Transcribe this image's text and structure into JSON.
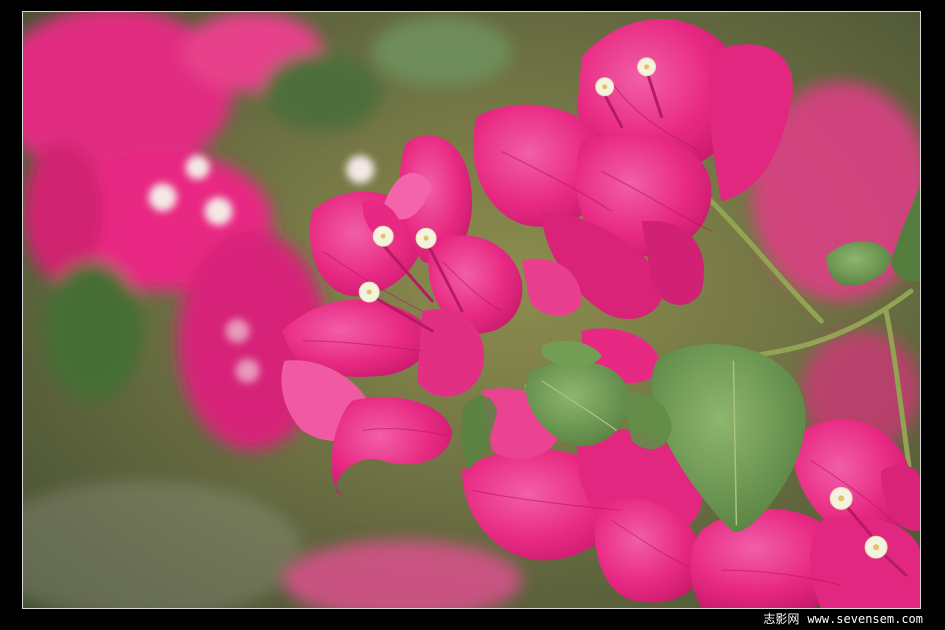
{
  "caption": {
    "brand": "志影网",
    "url": "www.sevensem.com"
  },
  "colors": {
    "background_green": "#5e6a3c",
    "petal_magenta": "#e8237f",
    "petal_light": "#f25aa6",
    "leaf_green": "#6e9a4e",
    "stem_green": "#8da24e",
    "flower_cream": "#f6f2df"
  }
}
